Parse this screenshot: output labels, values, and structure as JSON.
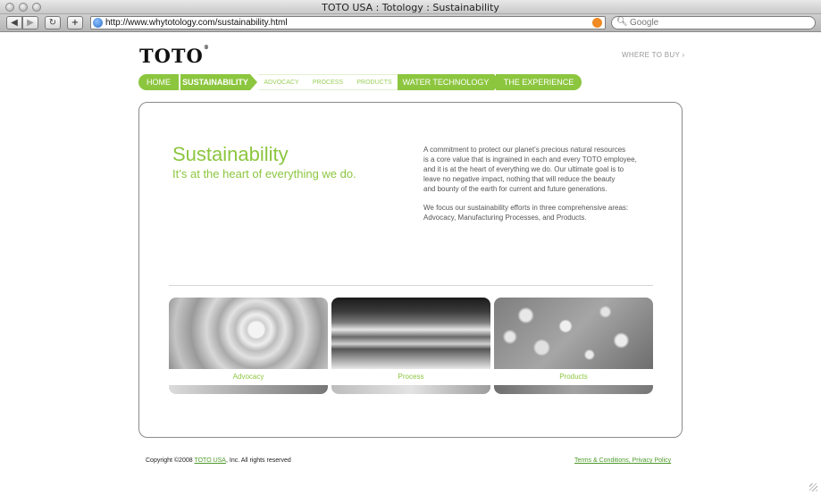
{
  "browser": {
    "window_title": "TOTO USA : Totology : Sustainability",
    "url": "http://www.whytotology.com/sustainability.html",
    "search_placeholder": "Google",
    "back_label": "◀",
    "forward_label": "▶",
    "reload_label": "↻",
    "add_label": "+"
  },
  "header": {
    "logo": "TOTO",
    "logo_mark": "®",
    "where_to_buy": "WHERE TO BUY ›"
  },
  "nav": {
    "items": [
      {
        "label": "HOME"
      },
      {
        "label": "SUSTAINABILITY"
      },
      {
        "label": "ADVOCACY"
      },
      {
        "label": "PROCESS"
      },
      {
        "label": "PRODUCTS"
      },
      {
        "label": "WATER TECHNOLOGY"
      },
      {
        "label": "THE EXPERIENCE"
      }
    ]
  },
  "main": {
    "title": "Sustainability",
    "subtitle": "It’s at the heart of everything we do.",
    "paragraph1_lines": [
      "A commitment to protect our planet’s precious natural resources",
      "is a core value that is ingrained in each and every TOTO employee,",
      "and it is at the heart of everything we do. Our ultimate goal is to",
      "leave no negative impact, nothing that will reduce the beauty",
      "and bounty of the earth for current and future generations."
    ],
    "paragraph2_lines": [
      "We focus our sustainability efforts in three comprehensive areas:",
      "Advocacy, Manufacturing Processes, and Products."
    ],
    "tiles": [
      {
        "label": "Advocacy"
      },
      {
        "label": "Process"
      },
      {
        "label": "Products"
      }
    ]
  },
  "footer": {
    "copyright_prefix": "Copyright ©2008 ",
    "copyright_link": "TOTO USA",
    "copyright_suffix": ", Inc. All rights reserved",
    "terms": "Terms & Conditions",
    "privacy": "Privacy Policy"
  },
  "colors": {
    "accent_green": "#8cc63f"
  }
}
